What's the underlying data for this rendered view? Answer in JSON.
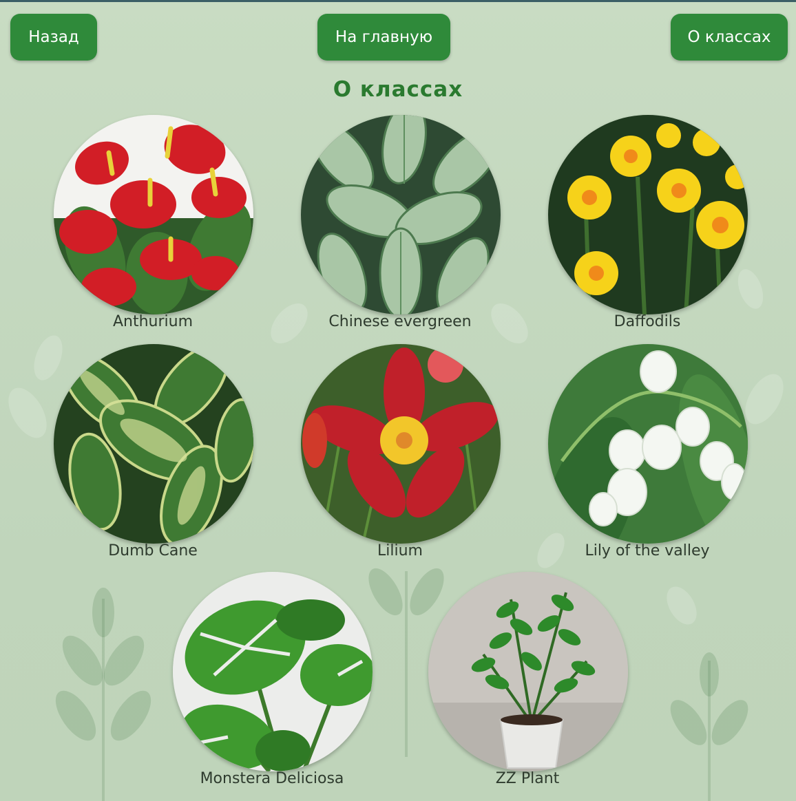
{
  "nav": {
    "back_label": "Назад",
    "home_label": "На главную",
    "about_label": "О классах"
  },
  "page": {
    "title": "О классах"
  },
  "plants": [
    {
      "name": "Anthurium",
      "image": "anthurium-image"
    },
    {
      "name": "Chinese evergreen",
      "image": "chinese-evergreen-image"
    },
    {
      "name": "Daffodils",
      "image": "daffodils-image"
    },
    {
      "name": "Dumb Cane",
      "image": "dumb-cane-image"
    },
    {
      "name": "Lilium",
      "image": "lilium-image"
    },
    {
      "name": "Lily of the valley",
      "image": "lily-of-the-valley-image"
    },
    {
      "name": "Monstera Deliciosa",
      "image": "monstera-image"
    },
    {
      "name": "ZZ Plant",
      "image": "zz-plant-image"
    }
  ],
  "colors": {
    "accent": "#2f8a3a",
    "title": "#2a7a2f",
    "background": "#c4d8bf",
    "label": "#2e3b2e"
  }
}
